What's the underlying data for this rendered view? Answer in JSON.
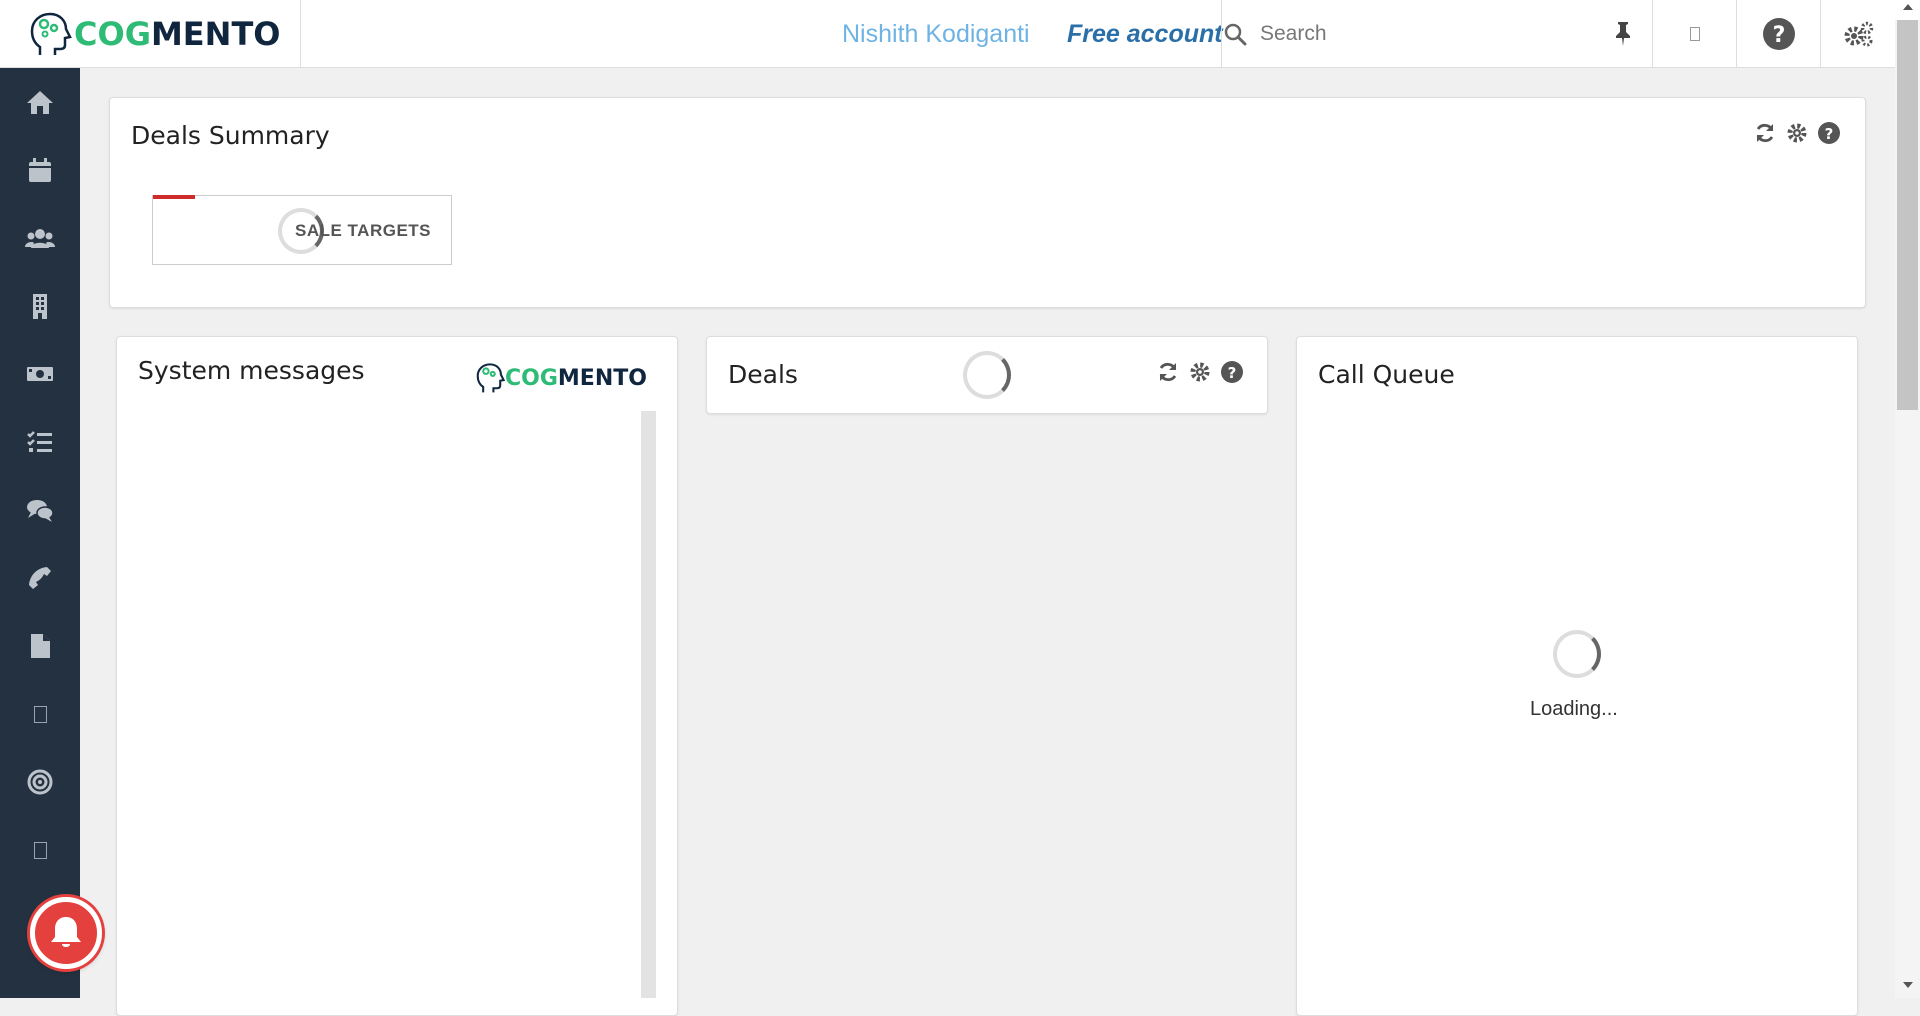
{
  "app": {
    "logo": {
      "part1": "COG",
      "part2": "MENTO"
    }
  },
  "header": {
    "user_name": "Nishith Kodiganti",
    "account_type": "Free account",
    "search": {
      "placeholder": "Search",
      "value": ""
    }
  },
  "sidebar": {
    "items": [
      {
        "icon": "home-icon"
      },
      {
        "icon": "calendar-icon"
      },
      {
        "icon": "contacts-icon"
      },
      {
        "icon": "companies-icon"
      },
      {
        "icon": "deals-icon"
      },
      {
        "icon": "tasks-icon"
      },
      {
        "icon": "cases-icon"
      },
      {
        "icon": "calls-icon"
      },
      {
        "icon": "documents-icon"
      },
      {
        "icon": "email-icon"
      },
      {
        "icon": "campaigns-icon"
      },
      {
        "icon": "forms-icon"
      }
    ]
  },
  "deals_summary": {
    "title": "Deals Summary",
    "card_label": "SALE TARGETS"
  },
  "system_messages": {
    "title": "System messages"
  },
  "deals": {
    "title": "Deals"
  },
  "call_queue": {
    "title": "Call Queue",
    "loading": "Loading..."
  },
  "colors": {
    "brand_green": "#2dbb75",
    "brand_dark": "#10263f",
    "sidebar_bg": "#243140",
    "notification_red": "#e3403e"
  }
}
